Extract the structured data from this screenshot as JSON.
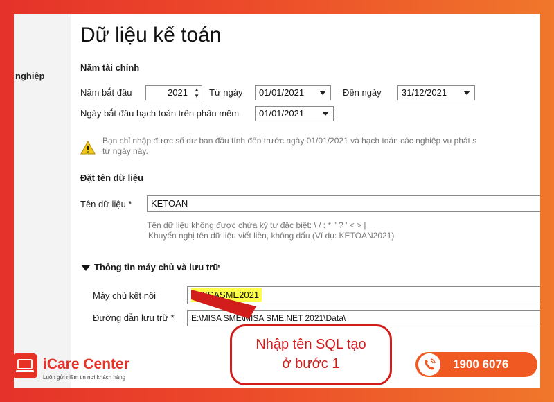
{
  "sidebar": {
    "label": "nghiệp"
  },
  "page_title": "Dữ liệu kế toán",
  "fiscal_year": {
    "heading": "Năm tài chính",
    "start_year_label": "Năm bắt đầu",
    "start_year_value": "2021",
    "from_date_label": "Từ ngày",
    "from_date_value": "01/01/2021",
    "to_date_label": "Đến ngày",
    "to_date_value": "31/12/2021",
    "accounting_start_label": "Ngày bắt đầu hạch toán trên phần mềm",
    "accounting_start_value": "01/01/2021",
    "warning_line1": "Bạn chỉ nhập được số dư ban đầu tính đến trước ngày 01/01/2021 và hạch toán các nghiệp vụ phát s",
    "warning_line2": "từ ngày này."
  },
  "data_name": {
    "heading": "Đặt tên dữ liệu",
    "name_label": "Tên dữ liệu *",
    "name_value": "KETOAN",
    "hint_line1": "Tên dữ liệu không được chứa ký tự đặc biệt: \\ / : * \" ? ' < > |",
    "hint_line2": "Khuyến nghị tên dữ liệu viết liền, không dấu (Ví dụ: KETOAN2021)"
  },
  "server": {
    "heading": "Thông tin máy chủ và lưu trữ",
    "server_label": "Máy chủ kết nối",
    "server_value": ".\\MISASME2021",
    "path_label": "Đường dẫn lưu trữ *",
    "path_value": "E:\\MISA SME\\MISA SME.NET 2021\\Data\\"
  },
  "annotation": {
    "line1": "Nhập tên SQL tạo",
    "line2": "ở bước 1",
    "color": "#d21d1d"
  },
  "brand": {
    "name": "iCare Center",
    "tagline": "Luôn gửi niềm tin nơi khách hàng",
    "hotline": "1900 6076",
    "color": "#e53126"
  }
}
